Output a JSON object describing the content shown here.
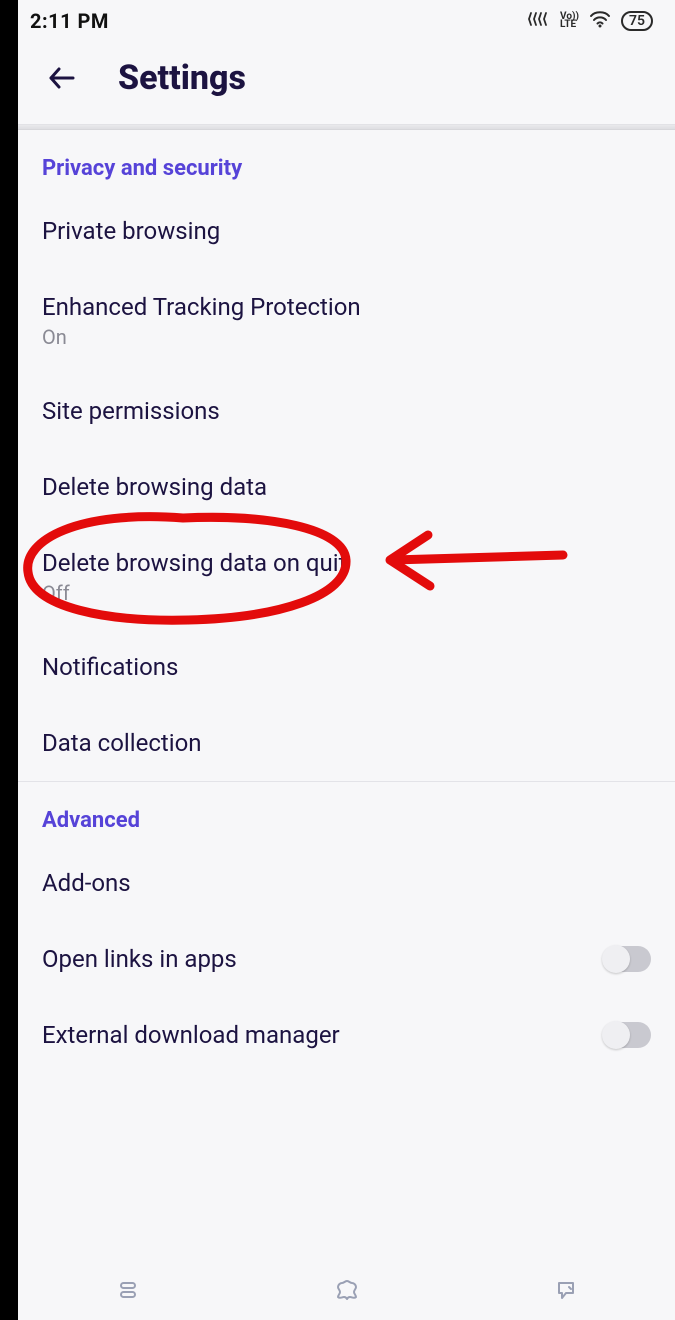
{
  "status": {
    "time": "2:11 PM",
    "lte_label": "Vo\nLTE",
    "battery": "75"
  },
  "header": {
    "title": "Settings"
  },
  "sections": {
    "privacy": {
      "header": "Privacy and security",
      "items": {
        "private_browsing": {
          "title": "Private browsing"
        },
        "etp": {
          "title": "Enhanced Tracking Protection",
          "sub": "On"
        },
        "site_permissions": {
          "title": "Site permissions"
        },
        "delete_data": {
          "title": "Delete browsing data"
        },
        "delete_on_quit": {
          "title": "Delete browsing data on quit",
          "sub": "Off"
        },
        "notifications": {
          "title": "Notifications"
        },
        "data_collection": {
          "title": "Data collection"
        }
      }
    },
    "advanced": {
      "header": "Advanced",
      "items": {
        "addons": {
          "title": "Add-ons"
        },
        "open_links": {
          "title": "Open links in apps"
        },
        "ext_dm": {
          "title": "External download manager"
        }
      }
    }
  }
}
